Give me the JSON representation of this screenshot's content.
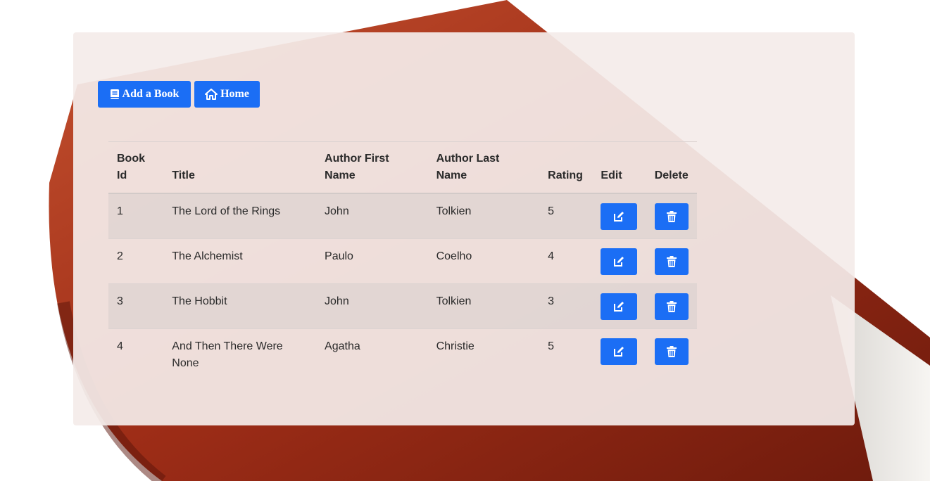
{
  "toolbar": {
    "add_label": "Add a Book",
    "home_label": "Home"
  },
  "table": {
    "headers": {
      "id": "Book Id",
      "title": "Title",
      "first": "Author First Name",
      "last": "Author Last Name",
      "rating": "Rating",
      "edit": "Edit",
      "delete": "Delete"
    },
    "rows": [
      {
        "id": "1",
        "title": "The Lord of the Rings",
        "first": "John",
        "last": "Tolkien",
        "rating": "5"
      },
      {
        "id": "2",
        "title": "The Alchemist",
        "first": "Paulo",
        "last": "Coelho",
        "rating": "4"
      },
      {
        "id": "3",
        "title": "The Hobbit",
        "first": "John",
        "last": "Tolkien",
        "rating": "3"
      },
      {
        "id": "4",
        "title": "And Then There Were None",
        "first": "Agatha",
        "last": "Christie",
        "rating": "5"
      }
    ]
  },
  "icons": {
    "add": "book-icon",
    "home": "home-icon",
    "edit": "edit-icon",
    "delete": "trash-icon"
  },
  "colors": {
    "button": "#1b6ef5",
    "panel": "#f4ecea",
    "book_cover": "#a8341c"
  }
}
